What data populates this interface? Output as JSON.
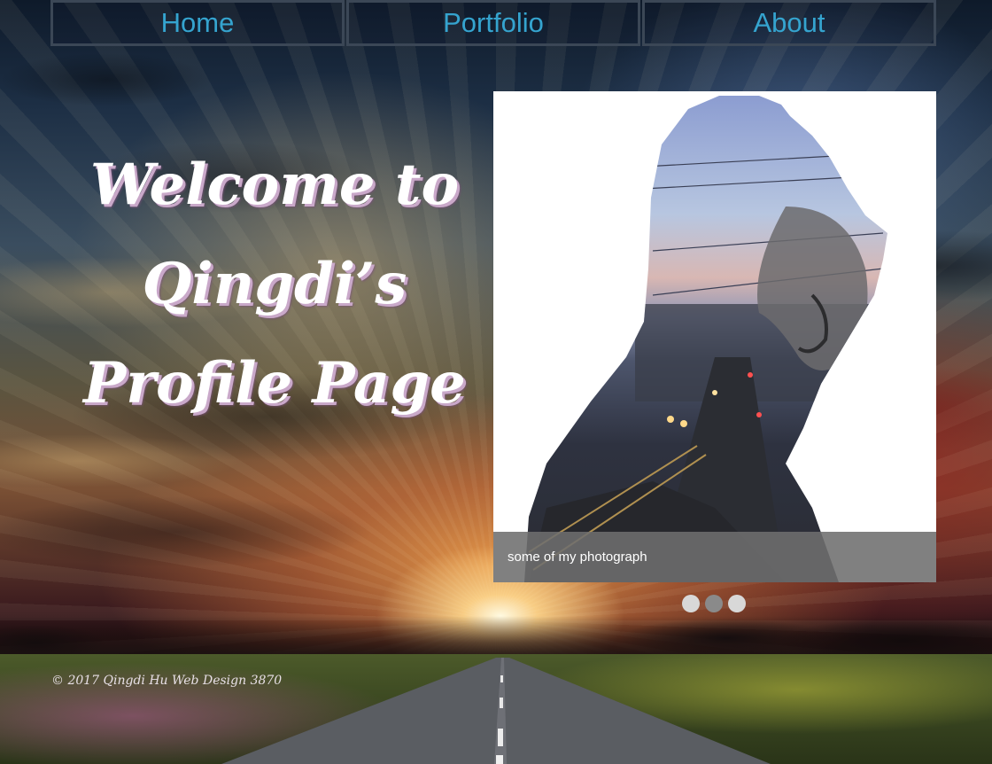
{
  "nav": {
    "items": [
      {
        "label": "Home"
      },
      {
        "label": "Portfolio"
      },
      {
        "label": "About"
      }
    ]
  },
  "hero": {
    "title_lines": [
      "Welcome to",
      "Qingdi’s",
      "Profile Page"
    ]
  },
  "slideshow": {
    "caption": "some of my photograph",
    "slide_count": 3,
    "active_index": 1
  },
  "footer": {
    "text": "© 2017 Qingdi Hu Web Design 3870"
  },
  "colors": {
    "nav_text": "#35a4cf",
    "nav_border": "#3b4756",
    "dot_inactive": "#d8d8d8",
    "dot_active": "#8a8a8a"
  }
}
